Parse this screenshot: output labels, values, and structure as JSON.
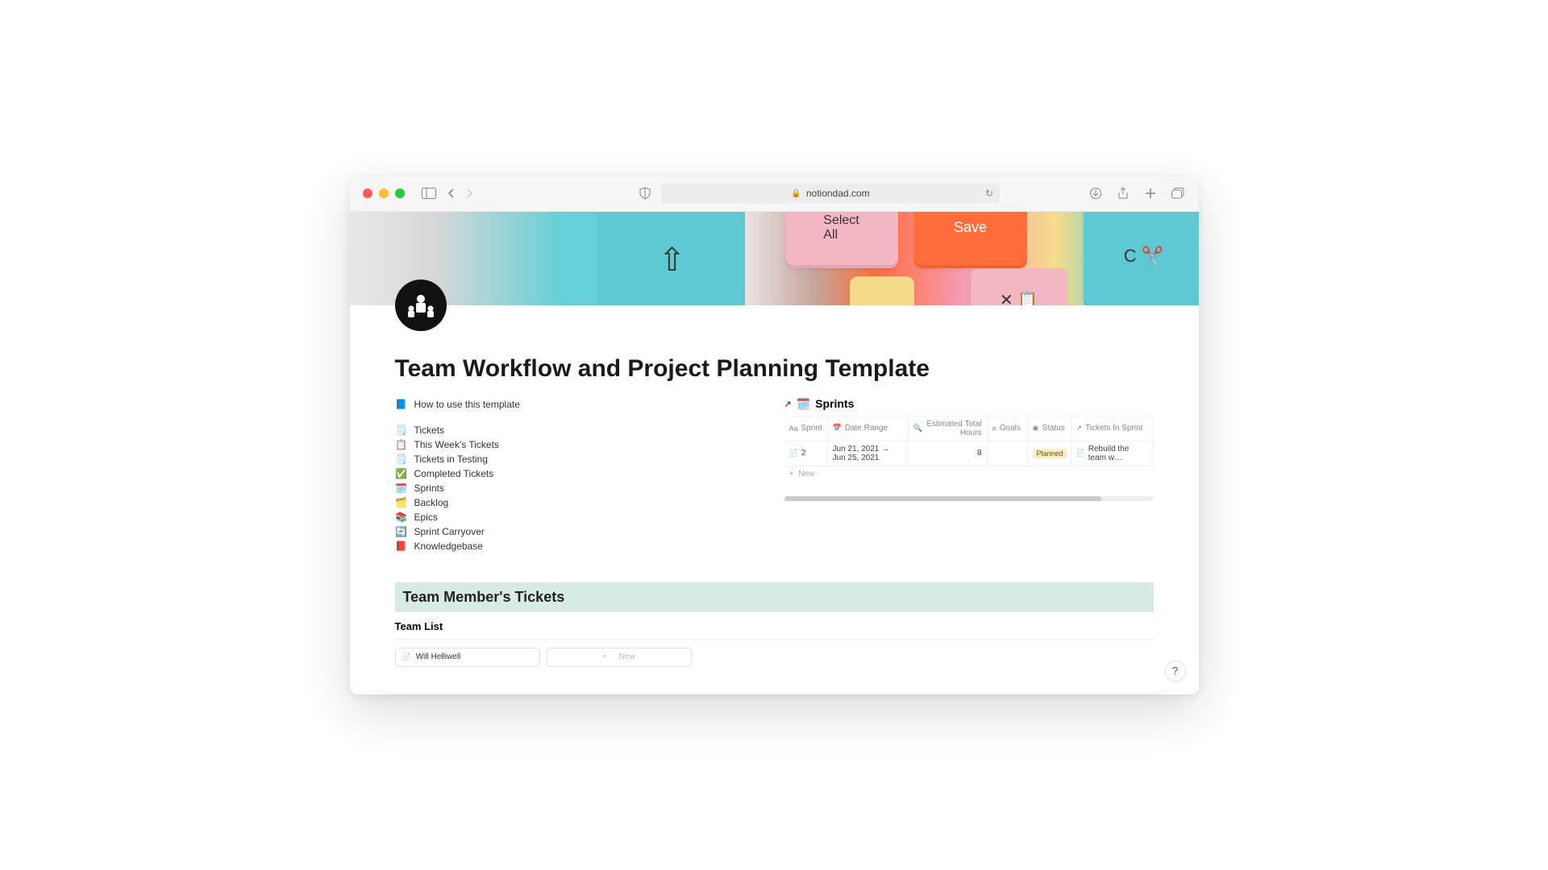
{
  "browser": {
    "url_domain": "notiondad.com"
  },
  "page": {
    "title": "Team Workflow and Project Planning Template"
  },
  "how_to": {
    "emoji": "📘",
    "label": "How to use this template"
  },
  "nav_links": [
    {
      "emoji": "🗒️",
      "label": "Tickets"
    },
    {
      "emoji": "📋",
      "label": "This Week's Tickets"
    },
    {
      "emoji": "🗒️",
      "label": "Tickets in Testing"
    },
    {
      "emoji": "✅",
      "label": "Completed Tickets"
    },
    {
      "emoji": "🗓️",
      "label": "Sprints"
    },
    {
      "emoji": "🗂️",
      "label": "Backlog"
    },
    {
      "emoji": "📚",
      "label": "Epics"
    },
    {
      "emoji": "🔄",
      "label": "Sprint Carryover"
    },
    {
      "emoji": "📕",
      "label": "Knowledgebase"
    }
  ],
  "sprints": {
    "emoji": "🗓️",
    "title": "Sprints",
    "columns": {
      "sprint": "Sprint",
      "date_range": "Date Range",
      "est_hours": "Estimated Total Hours",
      "goals": "Goals",
      "status": "Status",
      "tickets": "Tickets In Sprint"
    },
    "row": {
      "sprint": "2",
      "date_range": "Jun 21, 2021 → Jun 25, 2021",
      "est_hours": "8",
      "goals": "",
      "status": "Planned",
      "tickets": "Rebuild the team w…"
    },
    "new_label": "New"
  },
  "team_section": {
    "banner": "Team Member's Tickets",
    "list_title": "Team List",
    "members": [
      {
        "name": "Will Helliwell"
      }
    ],
    "new_label": "New"
  },
  "help": "?"
}
